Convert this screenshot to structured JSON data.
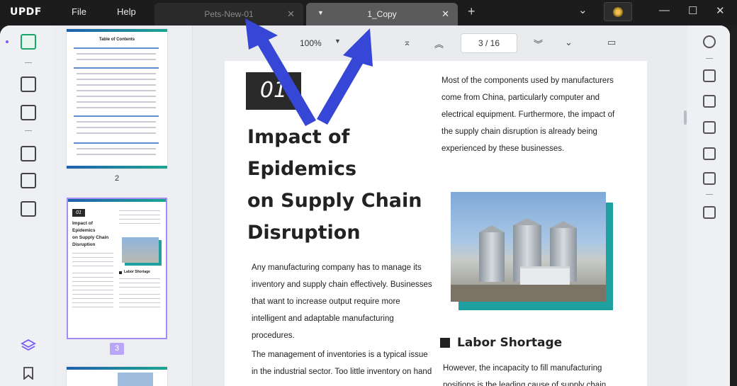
{
  "app": {
    "logo": "UPDF",
    "menu": [
      "File",
      "Help"
    ],
    "tabs": [
      {
        "label": "Pets-New-01",
        "active": false
      },
      {
        "label": "1_Copy",
        "active": true
      }
    ]
  },
  "viewer": {
    "zoom": "100%",
    "page_indicator": "3  /  16"
  },
  "thumbnails": {
    "pages": [
      {
        "number": "2",
        "title": "Table of Contents"
      },
      {
        "number": "3",
        "selected": true
      }
    ]
  },
  "document": {
    "number_badge": "01",
    "heading_lines": [
      "Impact of",
      "Epidemics",
      "on Supply Chain",
      "Disruption"
    ],
    "right_paragraph_lines": [
      "Most of the components used by manufacturers",
      "come from China, particularly computer and",
      "electrical equipment. Furthermore, the impact of",
      "the supply chain disruption is already being",
      "experienced by these businesses."
    ],
    "left_paragraph1_lines": [
      "Any manufacturing company has to manage its",
      "inventory and supply chain effectively. Businesses",
      "that want to increase output require more",
      "intelligent and adaptable manufacturing",
      "procedures."
    ],
    "left_paragraph2_lines": [
      "The management of inventories is a typical issue",
      "in the industrial sector. Too little inventory on hand"
    ],
    "section_title": "Labor Shortage",
    "section_lines": [
      "However, the incapacity to fill manufacturing",
      "positions is the leading cause of supply chain"
    ]
  },
  "colors": {
    "accent": "#1aa66a",
    "selection": "#a58cf5",
    "arrow": "#3646d6",
    "photo_frame": "#1fa0a0"
  }
}
